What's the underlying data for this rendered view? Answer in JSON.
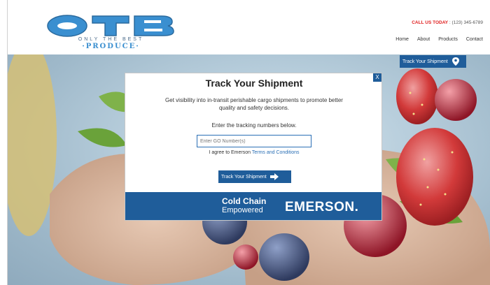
{
  "header": {
    "logo_main": "OTB",
    "logo_tag1": "ONLY THE BEST",
    "logo_tag2": "·PRODUCE·",
    "callus_label": "CALL US TODAY",
    "callus_number": " : (123) 345-6789",
    "nav": [
      "Home",
      "About",
      "Products",
      "Contact"
    ]
  },
  "track_tab": {
    "label": "Track Your Shipment",
    "icon": "map-pin-icon"
  },
  "modal": {
    "close": "X",
    "title": "Track Your Shipment",
    "desc": "Get visibility into in-transit perishable cargo shipments to promote better quality and safety decisions.",
    "enter": "Enter the tracking numbers below.",
    "input_placeholder": "Enter GO Number(s)",
    "agree_text": "I agree to Emerson ",
    "agree_link": "Terms and Conditions",
    "button_label": "Track Your Shipment",
    "footer_line1": "Cold Chain",
    "footer_line2": "Empowered",
    "footer_brand": "EMERSON."
  },
  "colors": {
    "brand_blue": "#1f5d9a",
    "accent_red": "#e02020",
    "logo_blue": "#3a8fd0"
  }
}
